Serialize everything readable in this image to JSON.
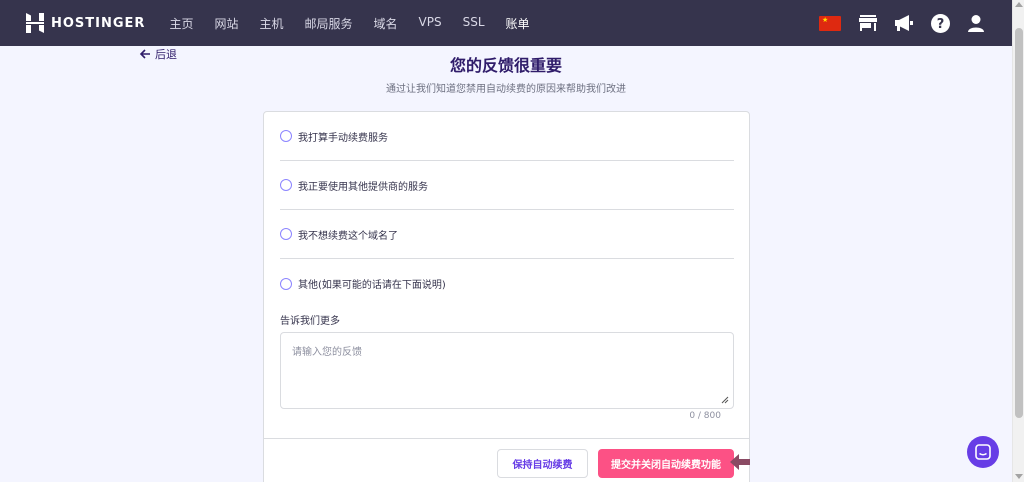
{
  "brand": {
    "name": "HOSTINGER"
  },
  "nav": [
    {
      "label": "主页"
    },
    {
      "label": "网站"
    },
    {
      "label": "主机"
    },
    {
      "label": "邮局服务"
    },
    {
      "label": "域名"
    },
    {
      "label": "VPS"
    },
    {
      "label": "SSL"
    },
    {
      "label": "账单"
    }
  ],
  "top_icons": [
    "china-flag-icon",
    "store-icon",
    "megaphone-icon",
    "help-icon",
    "user-icon"
  ],
  "back": {
    "label": "后退"
  },
  "heading": "您的反馈很重要",
  "subheading": "通过让我们知道您禁用自动续费的原因来帮助我们改进",
  "options": [
    {
      "label": "我打算手动续费服务"
    },
    {
      "label": "我正要使用其他提供商的服务"
    },
    {
      "label": "我不想续费这个域名了"
    },
    {
      "label": "其他(如果可能的话请在下面说明)"
    }
  ],
  "feedback": {
    "label": "告诉我们更多",
    "placeholder": "请输入您的反馈",
    "counter": "0 / 800"
  },
  "buttons": {
    "keep": "保持自动续费",
    "submit": "提交并关闭自动续费功能"
  },
  "colors": {
    "topbar": "#36344d",
    "accent": "#673de6",
    "submit": "#fc5185",
    "radio": "#8c85ff"
  }
}
